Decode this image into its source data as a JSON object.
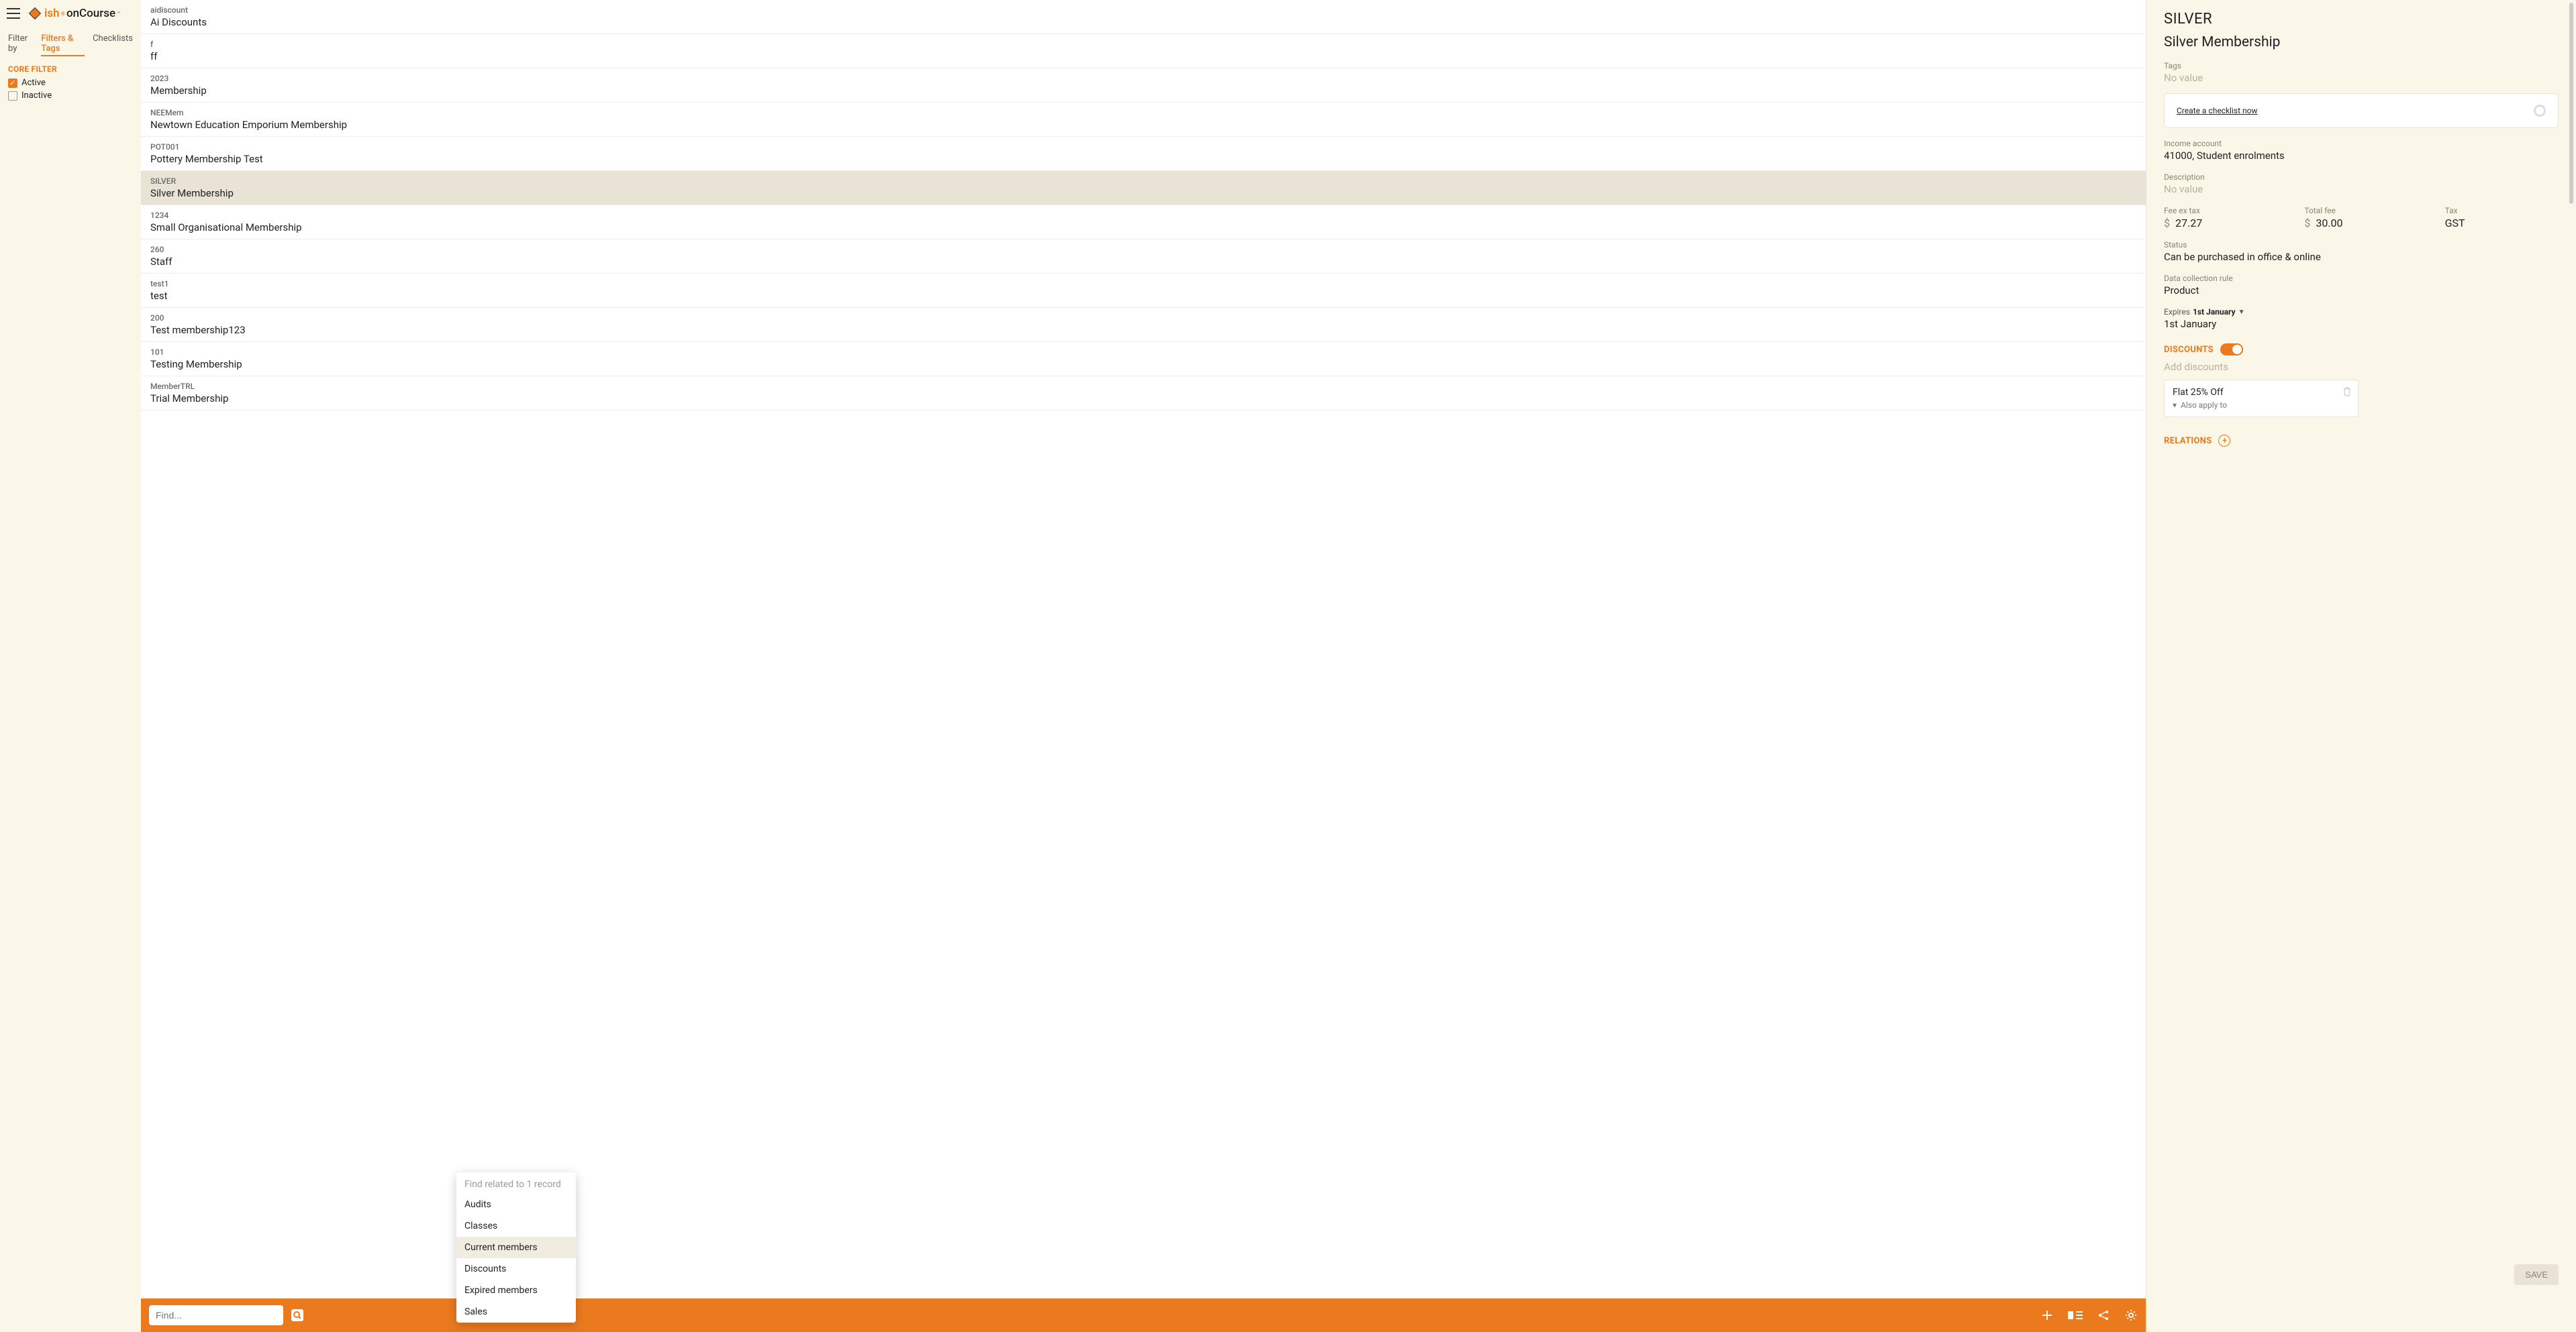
{
  "logo": {
    "ish": "ish",
    "oncourse": "onCourse"
  },
  "filter_tabs": {
    "filter_by": "Filter by",
    "filters_tags": "Filters & Tags",
    "checklists": "Checklists"
  },
  "core_filter": {
    "title": "CORE FILTER",
    "active": "Active",
    "inactive": "Inactive"
  },
  "list": [
    {
      "code": "aidiscount",
      "name": "Ai Discounts"
    },
    {
      "code": "f",
      "name": "ff"
    },
    {
      "code": "2023",
      "name": "Membership"
    },
    {
      "code": "NEEMem",
      "name": "Newtown Education Emporium Membership"
    },
    {
      "code": "POT001",
      "name": "Pottery Membership Test"
    },
    {
      "code": "SILVER",
      "name": "Silver Membership"
    },
    {
      "code": "1234",
      "name": "Small Organisational Membership"
    },
    {
      "code": "260",
      "name": "Staff"
    },
    {
      "code": "test1",
      "name": "test"
    },
    {
      "code": "200",
      "name": "Test membership123"
    },
    {
      "code": "101",
      "name": "Testing Membership"
    },
    {
      "code": "MemberTRL",
      "name": "Trial Membership"
    }
  ],
  "search": {
    "placeholder": "Find..."
  },
  "popup": {
    "title": "Find related to 1 record",
    "items": [
      "Audits",
      "Classes",
      "Current members",
      "Discounts",
      "Expired members",
      "Sales"
    ]
  },
  "detail": {
    "code": "SILVER",
    "name": "Silver Membership",
    "tags_label": "Tags",
    "tags_value": "No value",
    "checklist": "Create a checklist now",
    "income_label": "Income account",
    "income_value": "41000, Student enrolments",
    "desc_label": "Description",
    "desc_value": "No value",
    "fee_ex_label": "Fee ex tax",
    "fee_ex_value": "27.27",
    "total_label": "Total fee",
    "total_value": "30.00",
    "tax_label": "Tax",
    "tax_value": "GST",
    "status_label": "Status",
    "status_value": "Can be purchased in office & online",
    "dcr_label": "Data collection rule",
    "dcr_value": "Product",
    "expires_prefix": "Expires",
    "expires_bold": "1st January",
    "expires_value": "1st January",
    "discounts_title": "DISCOUNTS",
    "add_discounts": "Add discounts",
    "discount_card": {
      "title": "Flat 25% Off",
      "sub": "Also apply to"
    },
    "relations_title": "RELATIONS",
    "save": "SAVE"
  }
}
